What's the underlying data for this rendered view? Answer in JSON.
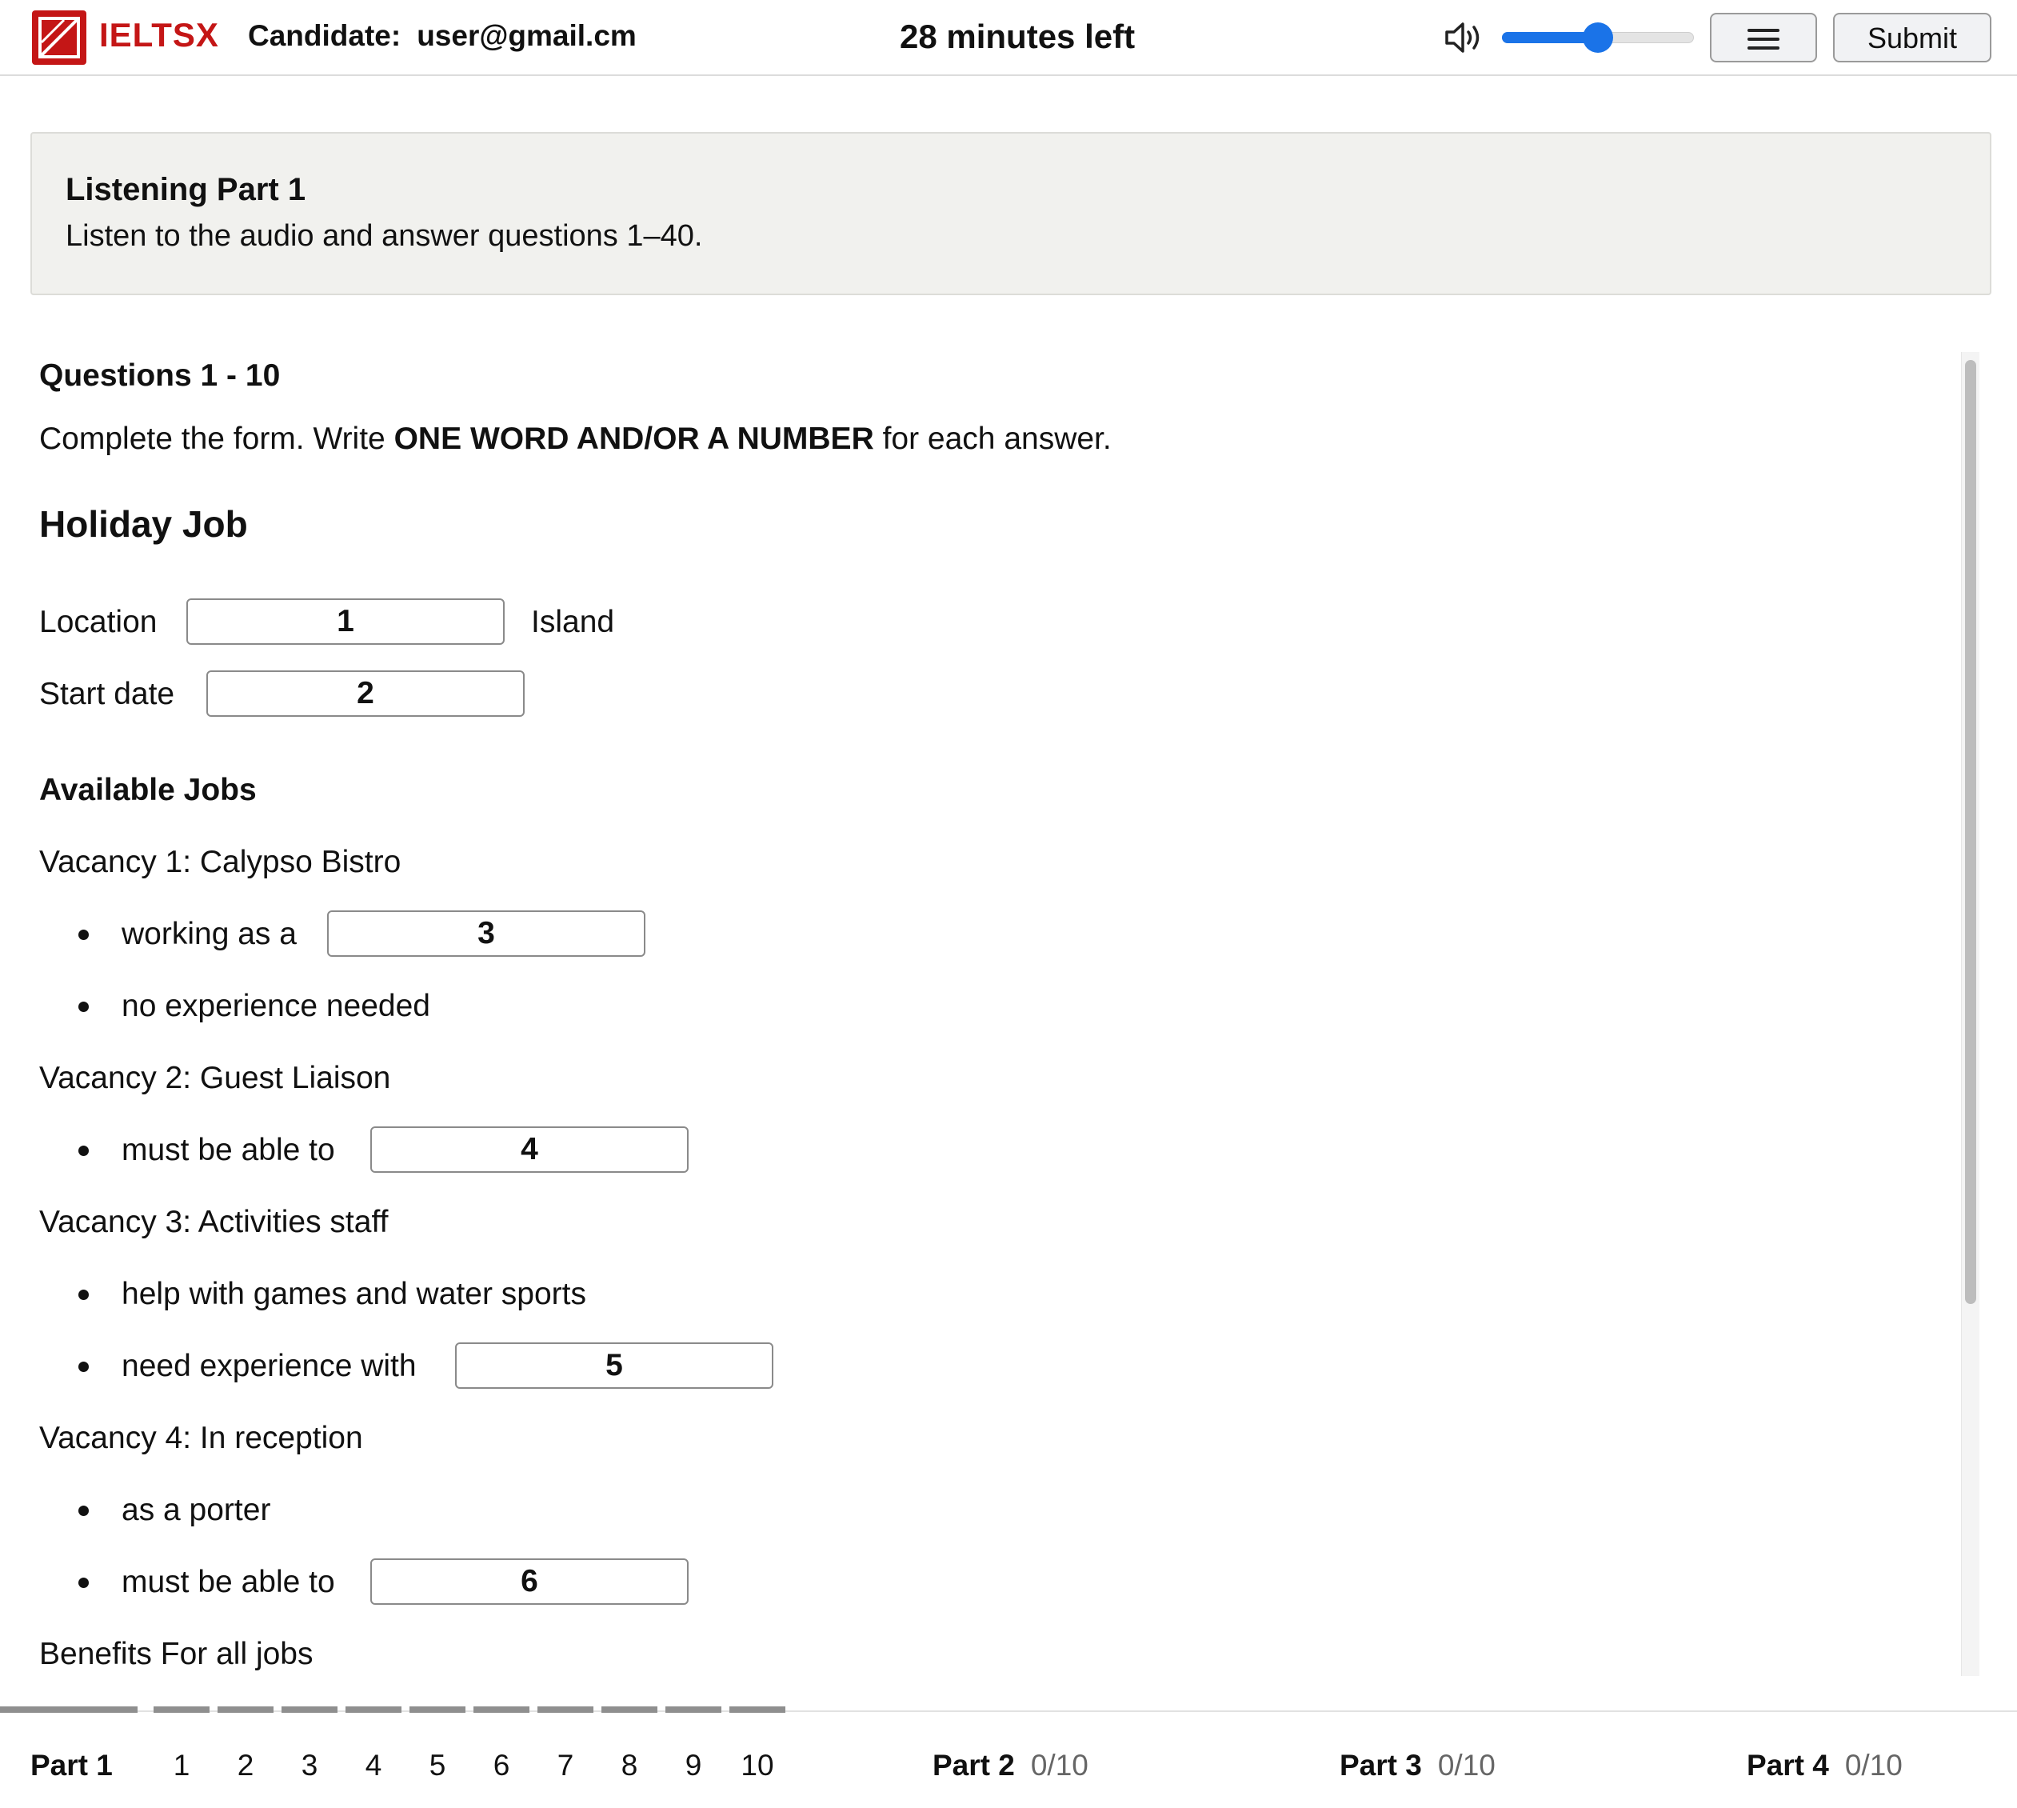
{
  "header": {
    "brand": "IELTSX",
    "candidate_label": "Candidate:",
    "candidate_value": "user@gmail.cm",
    "timer": "28 minutes left",
    "volume_level": 0.5,
    "submit_label": "Submit",
    "accent_color": "#c41616",
    "slider_color": "#1a73e8"
  },
  "part_box": {
    "title": "Listening Part 1",
    "description": "Listen to the audio and answer questions 1–40."
  },
  "questions": {
    "range_label": "Questions 1 - 10",
    "instruction_prefix": "Complete the form. Write ",
    "instruction_bold": "ONE WORD AND/OR A NUMBER",
    "instruction_suffix": " for each answer.",
    "form_title": "Holiday Job",
    "location_label": "Location",
    "location_suffix": "Island",
    "start_date_label": "Start date",
    "available_jobs": "Available Jobs",
    "vacancy1": "Vacancy 1: Calypso Bistro",
    "v1_item1": "working as a",
    "v1_item2": "no experience needed",
    "vacancy2": "Vacancy 2: Guest Liaison",
    "v2_item1": "must be able to",
    "vacancy3": "Vacancy 3: Activities staff",
    "v3_item1": "help with games and water sports",
    "v3_item2": "need experience with",
    "vacancy4": "Vacancy 4: In reception",
    "v4_item1": "as a porter",
    "v4_item2": "must be able to",
    "benefits": "Benefits For all jobs",
    "answers": [
      "1",
      "2",
      "3",
      "4",
      "5",
      "6"
    ]
  },
  "footer": {
    "part1_label": "Part 1",
    "question_numbers": [
      "1",
      "2",
      "3",
      "4",
      "5",
      "6",
      "7",
      "8",
      "9",
      "10"
    ],
    "part2_label": "Part 2",
    "part2_count": "0/10",
    "part3_label": "Part 3",
    "part3_count": "0/10",
    "part4_label": "Part 4",
    "part4_count": "0/10"
  }
}
